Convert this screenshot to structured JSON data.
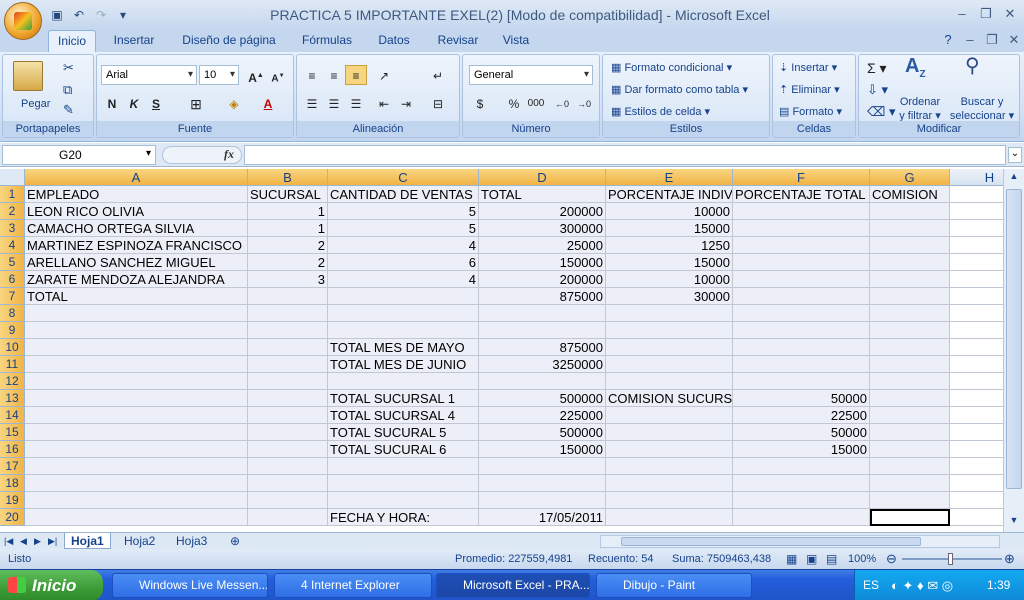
{
  "window": {
    "title": "PRACTICA 5 IMPORTANTE EXEL(2)  [Modo de compatibilidad] - Microsoft Excel"
  },
  "ribbon_tabs": [
    "Inicio",
    "Insertar",
    "Diseño de página",
    "Fórmulas",
    "Datos",
    "Revisar",
    "Vista"
  ],
  "groups": {
    "portapapeles": "Portapapeles",
    "fuente": "Fuente",
    "alineacion": "Alineación",
    "numero": "Número",
    "estilos": "Estilos",
    "celdas": "Celdas",
    "modificar": "Modificar"
  },
  "clipboard": {
    "paste": "Pegar"
  },
  "font": {
    "name": "Arial",
    "size": "10"
  },
  "number": {
    "format": "General"
  },
  "styles": {
    "conditional": "Formato condicional",
    "table": "Dar formato como tabla",
    "cell": "Estilos de celda"
  },
  "cells_group": {
    "insert": "Insertar",
    "delete": "Eliminar",
    "format": "Formato"
  },
  "editing": {
    "sort1": "Ordenar",
    "sort2": "y filtrar",
    "find1": "Buscar y",
    "find2": "seleccionar"
  },
  "formula_bar": {
    "name_box": "G20",
    "fx": "fx",
    "value": ""
  },
  "columns": [
    "A",
    "B",
    "C",
    "D",
    "E",
    "F",
    "G",
    "H"
  ],
  "rows": [
    [
      "EMPLEADO",
      "SUCURSAL",
      "CANTIDAD DE VENTAS",
      "TOTAL",
      "PORCENTAJE INDIV",
      "PORCENTAJE TOTAL",
      "COMISION"
    ],
    [
      "LEON RICO OLIVIA",
      "1",
      "5",
      "200000",
      "10000",
      "",
      ""
    ],
    [
      "CAMACHO ORTEGA SILVIA",
      "1",
      "5",
      "300000",
      "15000",
      "",
      ""
    ],
    [
      "MARTINEZ ESPINOZA FRANCISCO",
      "2",
      "4",
      "25000",
      "1250",
      "",
      ""
    ],
    [
      "ARELLANO SANCHEZ MIGUEL",
      "2",
      "6",
      "150000",
      "15000",
      "",
      ""
    ],
    [
      "ZARATE MENDOZA ALEJANDRA",
      "3",
      "4",
      "200000",
      "10000",
      "",
      ""
    ],
    [
      "TOTAL",
      "",
      "",
      "875000",
      "30000",
      "",
      ""
    ],
    [
      "",
      "",
      "",
      "",
      "",
      "",
      ""
    ],
    [
      "",
      "",
      "",
      "",
      "",
      "",
      ""
    ],
    [
      "",
      "",
      "TOTAL MES DE MAYO",
      "875000",
      "",
      "",
      ""
    ],
    [
      "",
      "",
      "TOTAL MES DE JUNIO",
      "3250000",
      "",
      "",
      ""
    ],
    [
      "",
      "",
      "",
      "",
      "",
      "",
      ""
    ],
    [
      "",
      "",
      "TOTAL SUCURSAL 1",
      "500000",
      "COMISION SUCURSAL",
      "50000",
      ""
    ],
    [
      "",
      "",
      "TOTAL SUCURSAL 4",
      "225000",
      "",
      "22500",
      ""
    ],
    [
      "",
      "",
      "TOTAL SUCURAL 5",
      "500000",
      "",
      "50000",
      ""
    ],
    [
      "",
      "",
      "TOTAL SUCURAL 6",
      "150000",
      "",
      "15000",
      ""
    ],
    [
      "",
      "",
      "",
      "",
      "",
      "",
      ""
    ],
    [
      "",
      "",
      "",
      "",
      "",
      "",
      ""
    ],
    [
      "",
      "",
      "",
      "",
      "",
      "",
      ""
    ],
    [
      "",
      "",
      "FECHA Y HORA:",
      "17/05/2011",
      "",
      "",
      ""
    ]
  ],
  "sheets": [
    "Hoja1",
    "Hoja2",
    "Hoja3"
  ],
  "status": {
    "ready": "Listo",
    "average": "Promedio: 227559,4981",
    "count": "Recuento: 54",
    "sum": "Suma: 7509463,438",
    "zoom": "100%"
  },
  "taskbar": {
    "start": "Inicio",
    "items": [
      "Windows Live Messen...",
      "4 Internet Explorer",
      "Microsoft Excel - PRA...",
      "Dibujo - Paint"
    ],
    "lang": "ES",
    "clock": "1:39"
  }
}
